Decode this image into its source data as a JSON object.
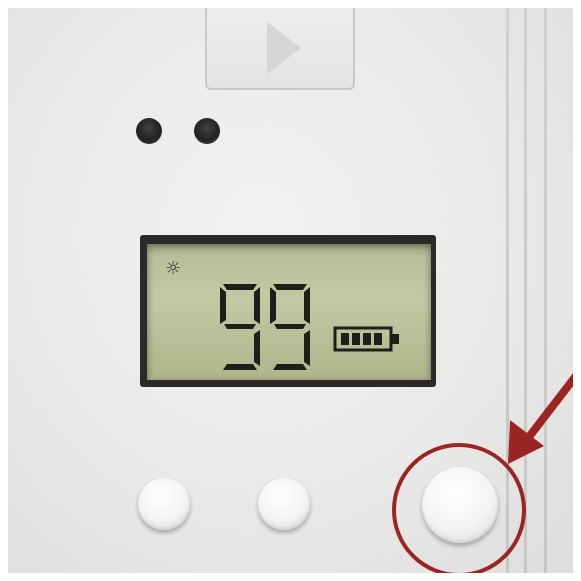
{
  "display": {
    "reading": "99",
    "mode_icon": "sun-icon",
    "battery_icon": "battery-full-icon",
    "battery_bars_filled": 4,
    "battery_bars_total": 4
  },
  "buttons": [
    {
      "name": "left-button"
    },
    {
      "name": "middle-button"
    },
    {
      "name": "right-button",
      "highlighted": true
    }
  ],
  "annotation": {
    "color": "#9b2524",
    "target": "right-button"
  },
  "colors": {
    "housing": "#e9eae8",
    "lcd_background": "#bcc09b",
    "lcd_segments": "#1e1f1a",
    "annotation_red": "#9b2524"
  }
}
